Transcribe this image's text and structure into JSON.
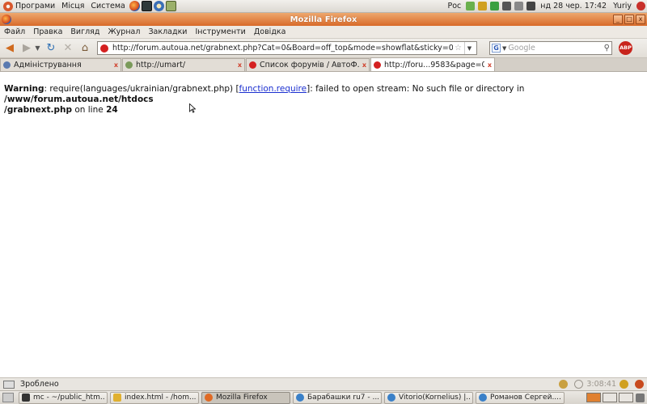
{
  "top_panel": {
    "menus": [
      "Програми",
      "Місця",
      "Система"
    ],
    "keyboard_layout": "Рос",
    "clock": "нд 28 чер. 17:42",
    "user": "Yuriy"
  },
  "window": {
    "title": "Mozilla Firefox",
    "controls": [
      "_",
      "□",
      "x"
    ]
  },
  "menubar": [
    "Файл",
    "Правка",
    "Вигляд",
    "Журнал",
    "Закладки",
    "Інструменти",
    "Довідка"
  ],
  "navbar": {
    "url": "http://forum.autoua.net/grabnext.php?Cat=0&Board=off_top&mode=showflat&sticky=0&dir=ne",
    "search_placeholder": "Google",
    "adblock_label": "ABP"
  },
  "tabs": [
    {
      "label": "Адміністрування",
      "fav": "#5a7ab0",
      "width": 150,
      "active": false
    },
    {
      "label": "http://umart/",
      "fav": "#7a9a5a",
      "width": 152,
      "active": false
    },
    {
      "label": "Список форумів / АвтоФ...",
      "fav": "#d42020",
      "width": 153,
      "active": false
    },
    {
      "label": "http://foru...9583&page=0",
      "fav": "#d42020",
      "width": 154,
      "active": true
    }
  ],
  "content": {
    "warning_label": "Warning",
    "message_part1": ": require(languages/ukrainian/grabnext.php) [",
    "link_text": "function.require",
    "message_part2": "]: failed to open stream: No such file or directory in ",
    "path_line1": "/www/forum.autoua.net/htdocs",
    "path_line2": "/grabnext.php",
    "on_line_text": " on line ",
    "line_number": "24"
  },
  "statusbar": {
    "text": "Зроблено",
    "timer": "3:08:41"
  },
  "taskbar": [
    {
      "label": "mc - ~/public_htm...",
      "icon": "#333333",
      "width": 110,
      "active": false
    },
    {
      "label": "index.html - /hom...",
      "icon": "#e0b030",
      "width": 110,
      "active": false
    },
    {
      "label": "Mozilla Firefox",
      "icon": "#e06a24",
      "width": 110,
      "active": true
    },
    {
      "label": "Барабашки ru7 - ...",
      "icon": "#3a80c8",
      "width": 110,
      "active": false
    },
    {
      "label": "Vitorio(Kornelius) |...",
      "icon": "#3a80c8",
      "width": 110,
      "active": false
    },
    {
      "label": "Романов Сергей....",
      "icon": "#3a80c8",
      "width": 110,
      "active": false
    }
  ]
}
